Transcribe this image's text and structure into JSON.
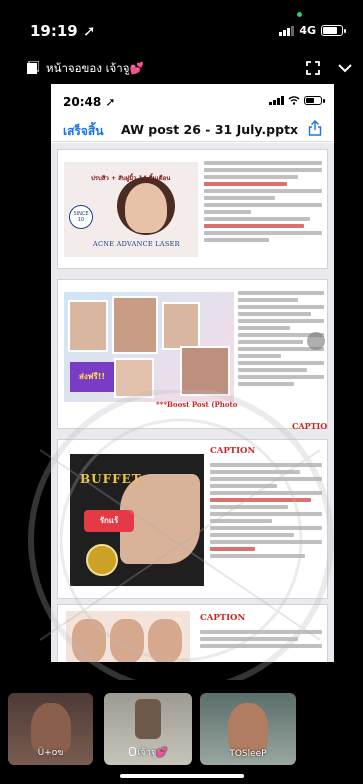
{
  "status_bar": {
    "time": "19:19",
    "network": "4G"
  },
  "share_header": {
    "title": "หน้าจอของ เจ้าจู💕"
  },
  "shared_screen": {
    "time": "20:48",
    "done_label": "เสร็จสิ้น",
    "file_title": "AW post 26 - 31 July.pptx",
    "slide1": {
      "promo_tagline": "ปรบสิว + สับฝูมิ้ว 14 สิ้นเดือน",
      "brand": "ACNE ADVANCE LASER",
      "badge": "SINCE 10"
    },
    "slide2": {
      "sale_text": "ส่งฟรี!!",
      "boost_post": "***Boost Post (Photo",
      "caption_label": "CAPTIO"
    },
    "slide3": {
      "caption_label": "CAPTION",
      "buffet_title": "BUFFET",
      "buffet_thai": "รักแร้"
    },
    "slide4": {
      "caption_label": "CAPTION"
    }
  },
  "participants": [
    {
      "name": "Ü+oข"
    },
    {
      "name": "เจ้าจู💕"
    },
    {
      "name": "TOSleeP"
    }
  ]
}
